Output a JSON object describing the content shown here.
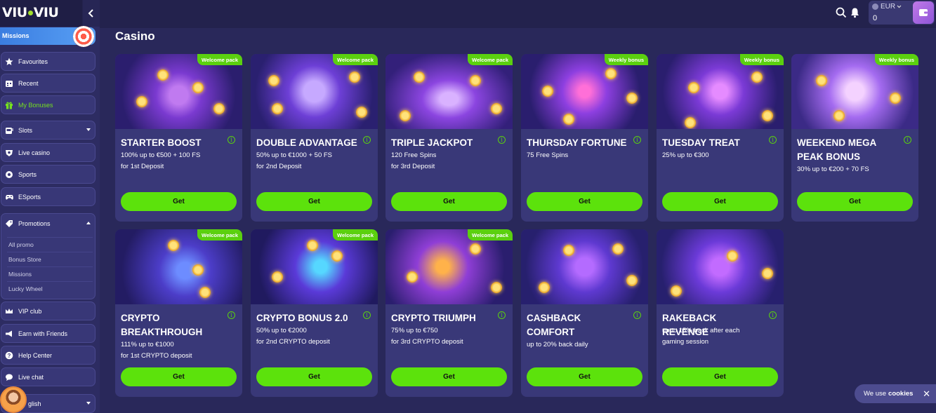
{
  "header": {
    "logo": "VIU VIU",
    "currency": "EUR",
    "balance": "0"
  },
  "sidebar": {
    "missions_label": "Missions",
    "items": [
      {
        "label": "Favourites",
        "icon": "star-icon"
      },
      {
        "label": "Recent",
        "icon": "calendar-icon"
      },
      {
        "label": "My Bonuses",
        "icon": "gift-icon"
      },
      {
        "label": "Slots",
        "icon": "slot-machine-icon"
      },
      {
        "label": "Live casino",
        "icon": "dealer-icon"
      },
      {
        "label": "Sports",
        "icon": "football-icon"
      },
      {
        "label": "ESports",
        "icon": "gamepad-icon"
      }
    ],
    "promotions": {
      "label": "Promotions",
      "children": [
        "All promo",
        "Bonus Store",
        "Missions",
        "Lucky Wheel"
      ]
    },
    "bottom_items": [
      {
        "label": "VIP club",
        "icon": "crown-icon"
      },
      {
        "label": "Earn with Friends",
        "icon": "megaphone-icon"
      },
      {
        "label": "Help Center",
        "icon": "question-icon"
      },
      {
        "label": "Live chat",
        "icon": "chat-icon"
      },
      {
        "label": "glish",
        "icon": "globe-icon"
      }
    ]
  },
  "main": {
    "title": "Casino",
    "cards": [
      {
        "badge": "Welcome pack",
        "title": "STARTER BOOST",
        "desc": [
          "100% up to €500 + 100 FS",
          "for 1st Deposit"
        ],
        "button": "Get"
      },
      {
        "badge": "Welcome pack",
        "title": "DOUBLE ADVANTAGE",
        "desc": [
          "50% up to €1000 + 50 FS",
          "for 2nd Deposit"
        ],
        "button": "Get"
      },
      {
        "badge": "Welcome pack",
        "title": "TRIPLE JACKPOT",
        "desc": [
          "120 Free Spins",
          "for 3rd Deposit"
        ],
        "button": "Get"
      },
      {
        "badge": "Weekly bonus",
        "title": "THURSDAY FORTUNE",
        "desc": [
          "75 Free Spins"
        ],
        "button": "Get"
      },
      {
        "badge": "Weekly bonus",
        "title": "TUESDAY TREAT",
        "desc": [
          "25% up to €300"
        ],
        "button": "Get"
      },
      {
        "badge": "Weekly bonus",
        "title": "WEEKEND MEGA PEAK BONUS",
        "desc": [
          "30% up to €200 + 70 FS"
        ],
        "button": "Get"
      },
      {
        "badge": "Welcome pack",
        "title": "CRYPTO BREAKTHROUGH",
        "desc": [
          "111% up to €1000",
          "for 1st CRYPTO deposit"
        ],
        "button": "Get"
      },
      {
        "badge": "Welcome pack",
        "title": "CRYPTO BONUS 2.0",
        "desc": [
          "50% up to €2000",
          "for 2nd CRYPTO deposit"
        ],
        "button": "Get"
      },
      {
        "badge": "Welcome pack",
        "title": "CRYPTO TRIUMPH",
        "desc": [
          "75% up to €750",
          "for 3rd CRYPTO deposit"
        ],
        "button": "Get"
      },
      {
        "badge": "",
        "title": "CASHBACK COMFORT",
        "desc": [
          "up to 20% back daily"
        ],
        "button": "Get"
      },
      {
        "badge": "",
        "title": "RAKEBACK REVENGE",
        "desc": [
          "up to 15% back after each",
          "gaming session"
        ],
        "button": "Get"
      }
    ]
  },
  "cookie": {
    "text": "We use",
    "bold": "cookies"
  },
  "colors": {
    "accent": "#5ce20c",
    "background": "#29285a",
    "card": "#393878",
    "sidebar": "#2d2c62"
  }
}
